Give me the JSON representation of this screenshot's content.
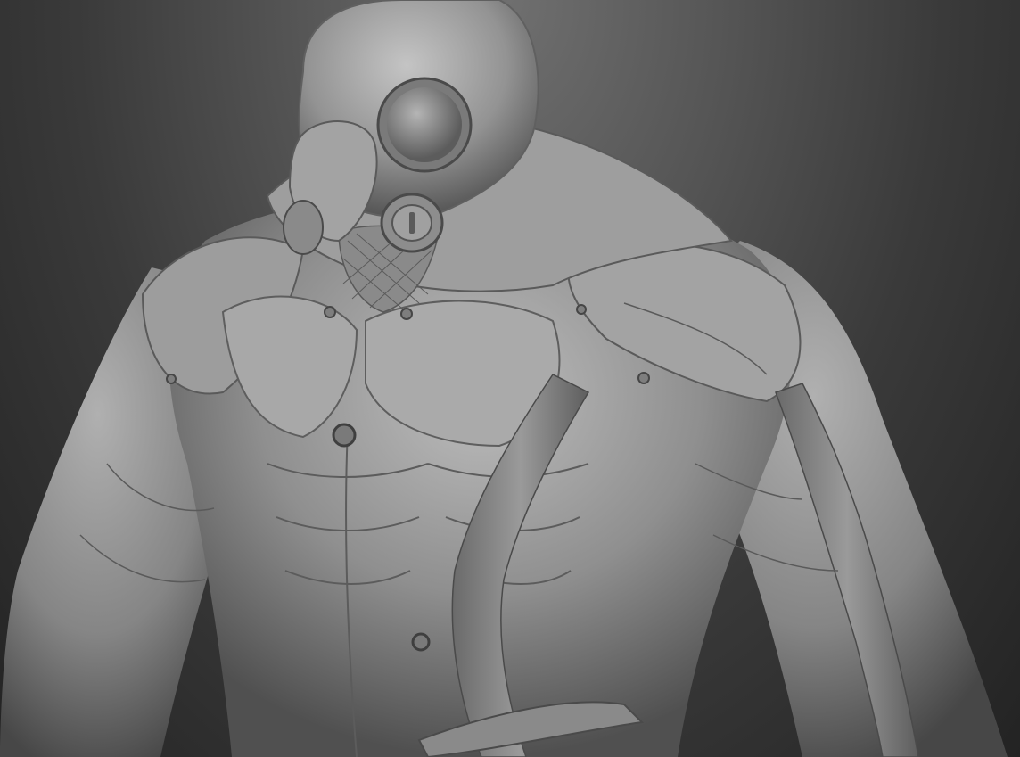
{
  "scene": {
    "subject": "sculpted-figure",
    "colors": {
      "background_top": "#6f6f6f",
      "background_bottom": "#232323",
      "clay_light": "#b8b8b8",
      "clay_mid": "#8c8c8c",
      "clay_dark": "#4a4a4a"
    }
  }
}
